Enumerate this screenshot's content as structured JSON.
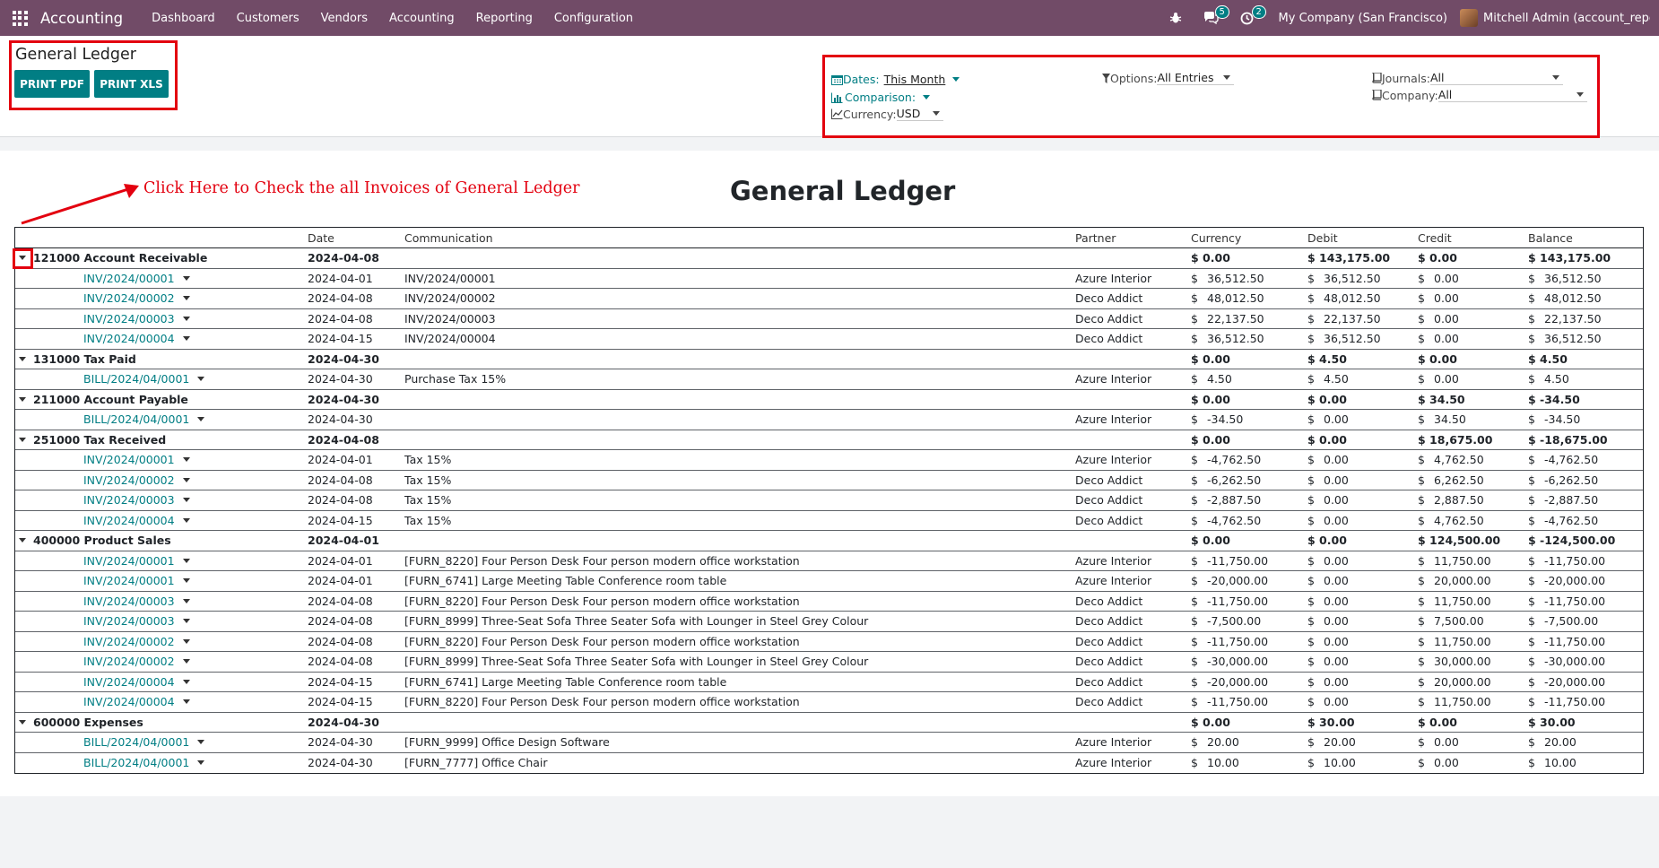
{
  "navbar": {
    "brand": "Accounting",
    "menu": [
      "Dashboard",
      "Customers",
      "Vendors",
      "Accounting",
      "Reporting",
      "Configuration"
    ],
    "messages_count": "5",
    "activities_count": "2",
    "company": "My Company (San Francisco)",
    "user": "Mitchell Admin (account_report_multi..."
  },
  "control": {
    "title": "General Ledger",
    "print_pdf": "PRINT PDF",
    "print_xls": "PRINT XLS",
    "filters": {
      "dates_label": "Dates:",
      "dates_value": "This Month",
      "comparison_label": "Comparison:",
      "currency_label": "Currency:",
      "currency_value": "USD",
      "options_label": "Options:",
      "options_value": "All Entries",
      "journals_label": "Journals:",
      "journals_value": "All",
      "company_label": "Company:",
      "company_value": "All"
    }
  },
  "annotation": "Click Here to Check the all Invoices of General Ledger",
  "report": {
    "title": "General Ledger",
    "columns": {
      "date": "Date",
      "communication": "Communication",
      "partner": "Partner",
      "currency": "Currency",
      "debit": "Debit",
      "credit": "Credit",
      "balance": "Balance"
    },
    "rows": [
      {
        "type": "group",
        "name": "121000 Account Receivable",
        "date": "2024-04-08",
        "currency": "$ 0.00",
        "debit": "$ 143,175.00",
        "credit": "$ 0.00",
        "balance": "$ 143,175.00"
      },
      {
        "type": "line",
        "move": "INV/2024/00001",
        "date": "2024-04-01",
        "comm": "INV/2024/00001",
        "partner": "Azure Interior",
        "currency": "36,512.50",
        "debit": "36,512.50",
        "credit": "0.00",
        "balance": "36,512.50"
      },
      {
        "type": "line",
        "move": "INV/2024/00002",
        "date": "2024-04-08",
        "comm": "INV/2024/00002",
        "partner": "Deco Addict",
        "currency": "48,012.50",
        "debit": "48,012.50",
        "credit": "0.00",
        "balance": "48,012.50"
      },
      {
        "type": "line",
        "move": "INV/2024/00003",
        "date": "2024-04-08",
        "comm": "INV/2024/00003",
        "partner": "Deco Addict",
        "currency": "22,137.50",
        "debit": "22,137.50",
        "credit": "0.00",
        "balance": "22,137.50"
      },
      {
        "type": "line",
        "move": "INV/2024/00004",
        "date": "2024-04-15",
        "comm": "INV/2024/00004",
        "partner": "Deco Addict",
        "currency": "36,512.50",
        "debit": "36,512.50",
        "credit": "0.00",
        "balance": "36,512.50"
      },
      {
        "type": "group",
        "name": "131000 Tax Paid",
        "date": "2024-04-30",
        "currency": "$ 0.00",
        "debit": "$ 4.50",
        "credit": "$ 0.00",
        "balance": "$ 4.50"
      },
      {
        "type": "line",
        "move": "BILL/2024/04/0001",
        "date": "2024-04-30",
        "comm": "Purchase Tax 15%",
        "partner": "Azure Interior",
        "currency": "4.50",
        "debit": "4.50",
        "credit": "0.00",
        "balance": "4.50"
      },
      {
        "type": "group",
        "name": "211000 Account Payable",
        "date": "2024-04-30",
        "currency": "$ 0.00",
        "debit": "$ 0.00",
        "credit": "$ 34.50",
        "balance": "$ -34.50"
      },
      {
        "type": "line",
        "move": "BILL/2024/04/0001",
        "date": "2024-04-30",
        "comm": "",
        "partner": "Azure Interior",
        "currency": "-34.50",
        "debit": "0.00",
        "credit": "34.50",
        "balance": "-34.50"
      },
      {
        "type": "group",
        "name": "251000 Tax Received",
        "date": "2024-04-08",
        "currency": "$ 0.00",
        "debit": "$ 0.00",
        "credit": "$ 18,675.00",
        "balance": "$ -18,675.00"
      },
      {
        "type": "line",
        "move": "INV/2024/00001",
        "date": "2024-04-01",
        "comm": "Tax 15%",
        "partner": "Azure Interior",
        "currency": "-4,762.50",
        "debit": "0.00",
        "credit": "4,762.50",
        "balance": "-4,762.50"
      },
      {
        "type": "line",
        "move": "INV/2024/00002",
        "date": "2024-04-08",
        "comm": "Tax 15%",
        "partner": "Deco Addict",
        "currency": "-6,262.50",
        "debit": "0.00",
        "credit": "6,262.50",
        "balance": "-6,262.50"
      },
      {
        "type": "line",
        "move": "INV/2024/00003",
        "date": "2024-04-08",
        "comm": "Tax 15%",
        "partner": "Deco Addict",
        "currency": "-2,887.50",
        "debit": "0.00",
        "credit": "2,887.50",
        "balance": "-2,887.50"
      },
      {
        "type": "line",
        "move": "INV/2024/00004",
        "date": "2024-04-15",
        "comm": "Tax 15%",
        "partner": "Deco Addict",
        "currency": "-4,762.50",
        "debit": "0.00",
        "credit": "4,762.50",
        "balance": "-4,762.50"
      },
      {
        "type": "group",
        "name": "400000 Product Sales",
        "date": "2024-04-01",
        "currency": "$ 0.00",
        "debit": "$ 0.00",
        "credit": "$ 124,500.00",
        "balance": "$ -124,500.00"
      },
      {
        "type": "line",
        "move": "INV/2024/00001",
        "date": "2024-04-01",
        "comm": "[FURN_8220] Four Person Desk Four person modern office workstation",
        "partner": "Azure Interior",
        "currency": "-11,750.00",
        "debit": "0.00",
        "credit": "11,750.00",
        "balance": "-11,750.00"
      },
      {
        "type": "line",
        "move": "INV/2024/00001",
        "date": "2024-04-01",
        "comm": "[FURN_6741] Large Meeting Table Conference room table",
        "partner": "Azure Interior",
        "currency": "-20,000.00",
        "debit": "0.00",
        "credit": "20,000.00",
        "balance": "-20,000.00"
      },
      {
        "type": "line",
        "move": "INV/2024/00003",
        "date": "2024-04-08",
        "comm": "[FURN_8220] Four Person Desk Four person modern office workstation",
        "partner": "Deco Addict",
        "currency": "-11,750.00",
        "debit": "0.00",
        "credit": "11,750.00",
        "balance": "-11,750.00"
      },
      {
        "type": "line",
        "move": "INV/2024/00003",
        "date": "2024-04-08",
        "comm": "[FURN_8999] Three-Seat Sofa Three Seater Sofa with Lounger in Steel Grey Colour",
        "partner": "Deco Addict",
        "currency": "-7,500.00",
        "debit": "0.00",
        "credit": "7,500.00",
        "balance": "-7,500.00"
      },
      {
        "type": "line",
        "move": "INV/2024/00002",
        "date": "2024-04-08",
        "comm": "[FURN_8220] Four Person Desk Four person modern office workstation",
        "partner": "Deco Addict",
        "currency": "-11,750.00",
        "debit": "0.00",
        "credit": "11,750.00",
        "balance": "-11,750.00"
      },
      {
        "type": "line",
        "move": "INV/2024/00002",
        "date": "2024-04-08",
        "comm": "[FURN_8999] Three-Seat Sofa Three Seater Sofa with Lounger in Steel Grey Colour",
        "partner": "Deco Addict",
        "currency": "-30,000.00",
        "debit": "0.00",
        "credit": "30,000.00",
        "balance": "-30,000.00"
      },
      {
        "type": "line",
        "move": "INV/2024/00004",
        "date": "2024-04-15",
        "comm": "[FURN_6741] Large Meeting Table Conference room table",
        "partner": "Deco Addict",
        "currency": "-20,000.00",
        "debit": "0.00",
        "credit": "20,000.00",
        "balance": "-20,000.00"
      },
      {
        "type": "line",
        "move": "INV/2024/00004",
        "date": "2024-04-15",
        "comm": "[FURN_8220] Four Person Desk Four person modern office workstation",
        "partner": "Deco Addict",
        "currency": "-11,750.00",
        "debit": "0.00",
        "credit": "11,750.00",
        "balance": "-11,750.00"
      },
      {
        "type": "group",
        "name": "600000 Expenses",
        "date": "2024-04-30",
        "currency": "$ 0.00",
        "debit": "$ 30.00",
        "credit": "$ 0.00",
        "balance": "$ 30.00"
      },
      {
        "type": "line",
        "move": "BILL/2024/04/0001",
        "date": "2024-04-30",
        "comm": "[FURN_9999] Office Design Software",
        "partner": "Azure Interior",
        "currency": "20.00",
        "debit": "20.00",
        "credit": "0.00",
        "balance": "20.00"
      },
      {
        "type": "line",
        "move": "BILL/2024/04/0001",
        "date": "2024-04-30",
        "comm": "[FURN_7777] Office Chair",
        "partner": "Azure Interior",
        "currency": "10.00",
        "debit": "10.00",
        "credit": "0.00",
        "balance": "10.00"
      }
    ]
  }
}
